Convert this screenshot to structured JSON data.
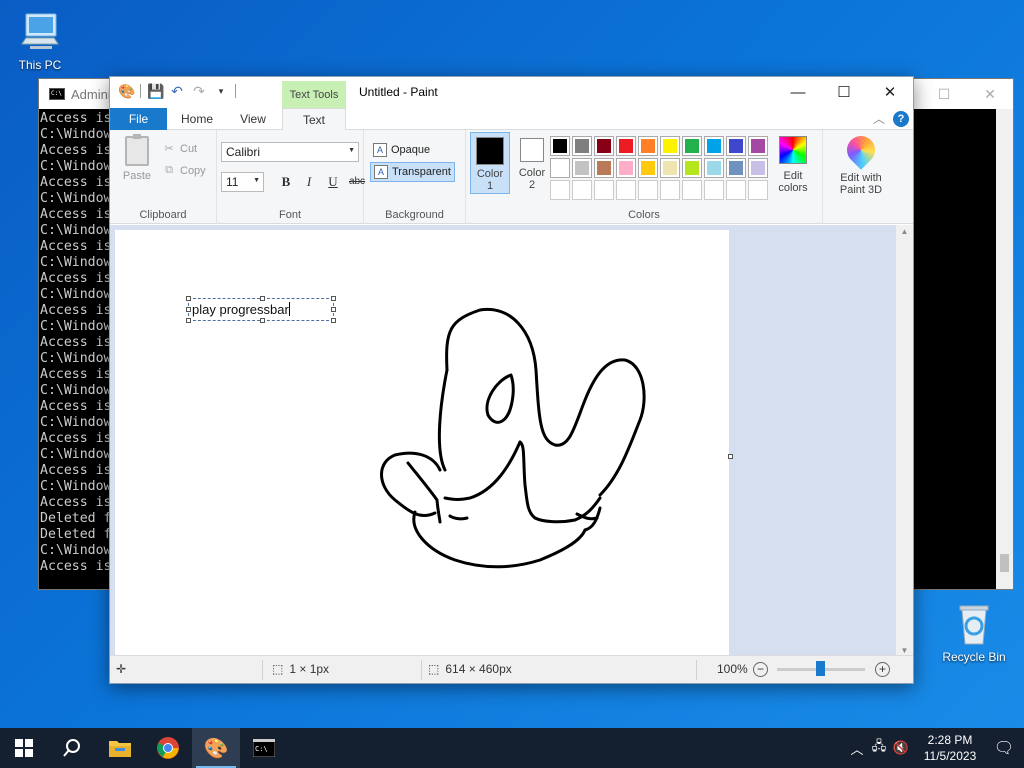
{
  "desktop": {
    "icons": [
      {
        "label": "This PC",
        "icon": "computer-icon"
      },
      {
        "label": "Recycle Bin",
        "icon": "recycle-bin-icon"
      }
    ]
  },
  "cmd": {
    "title": "Admini",
    "lines": [
      "Access is",
      "C:\\Window",
      "Access is",
      "C:\\Window",
      "Access is",
      "C:\\Window",
      "Access is",
      "C:\\Window",
      "Access is",
      "C:\\Window",
      "Access is",
      "C:\\Window",
      "Access is",
      "C:\\Window",
      "Access is",
      "C:\\Window",
      "Access is",
      "C:\\Window",
      "Access is",
      "C:\\Window",
      "Access is",
      "C:\\Window",
      "Access is",
      "C:\\Window",
      "Access is",
      "Deleted f",
      "Deleted f",
      "C:\\Window",
      "Access is"
    ]
  },
  "paint": {
    "title": "Untitled - Paint",
    "contextual_tab": "Text Tools",
    "tabs": {
      "file": "File",
      "home": "Home",
      "view": "View",
      "text": "Text"
    },
    "clipboard": {
      "paste": "Paste",
      "cut": "Cut",
      "copy": "Copy",
      "group": "Clipboard"
    },
    "font": {
      "family": "Calibri",
      "size": "11",
      "bold": "B",
      "italic": "I",
      "underline": "U",
      "strike": "abc",
      "group": "Font"
    },
    "background": {
      "opaque": "Opaque",
      "transparent": "Transparent",
      "selected": "transparent",
      "group": "Background"
    },
    "colors": {
      "color1_label": "Color\n1",
      "color2_label": "Color\n2",
      "color1_label_a": "Color",
      "color1_label_b": "1",
      "color2_label_a": "Color",
      "color2_label_b": "2",
      "color1": "#000000",
      "color2": "#ffffff",
      "edit_a": "Edit",
      "edit_b": "colors",
      "group": "Colors",
      "palette": [
        "#000000",
        "#7f7f7f",
        "#880015",
        "#ed1c24",
        "#ff7f27",
        "#fff200",
        "#22b14c",
        "#00a2e8",
        "#3f48cc",
        "#a349a4",
        "#ffffff",
        "#c3c3c3",
        "#b97a57",
        "#ffaec9",
        "#ffc90e",
        "#efe4b0",
        "#b5e61d",
        "#99d9ea",
        "#7092be",
        "#c8bfe7",
        "",
        "",
        "",
        "",
        "",
        "",
        "",
        "",
        "",
        ""
      ]
    },
    "paint3d": {
      "line1": "Edit with",
      "line2": "Paint 3D"
    },
    "canvas": {
      "text": "play progressbar",
      "width": 614,
      "height": 430
    },
    "status": {
      "cursor": "",
      "selection": "1 × 1px",
      "size": "614 × 460px",
      "zoom": "100%",
      "zoom_value": 1.0
    }
  },
  "taskbar": {
    "apps": [
      "start-icon",
      "search-icon",
      "file-explorer-icon",
      "chrome-icon",
      "paint-icon",
      "cmd-icon"
    ],
    "active": "paint-icon",
    "time": "2:28 PM",
    "date": "11/5/2023"
  }
}
